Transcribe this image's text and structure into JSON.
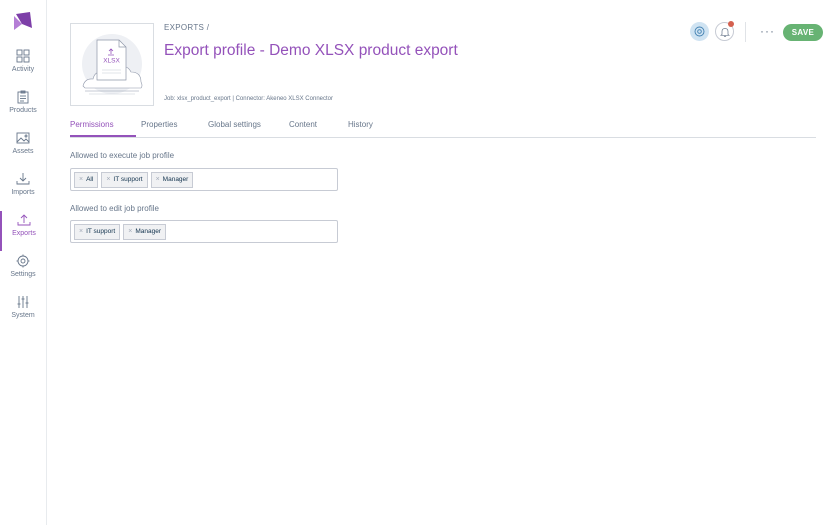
{
  "colors": {
    "accent": "#9452ba",
    "save": "#67b373",
    "notification": "#d4604f",
    "help": "#cfe3f2"
  },
  "sidebar": {
    "items": [
      {
        "label": "Activity",
        "icon": "grid-icon",
        "active": false
      },
      {
        "label": "Products",
        "icon": "clipboard-icon",
        "active": false
      },
      {
        "label": "Assets",
        "icon": "image-icon",
        "active": false
      },
      {
        "label": "Imports",
        "icon": "import-icon",
        "active": false
      },
      {
        "label": "Exports",
        "icon": "export-icon",
        "active": true
      },
      {
        "label": "Settings",
        "icon": "gear-icon",
        "active": false
      },
      {
        "label": "System",
        "icon": "sliders-icon",
        "active": false
      }
    ]
  },
  "header": {
    "breadcrumb": "EXPORTS /",
    "title": "Export profile - Demo XLSX product export",
    "meta": "Job: xlsx_product_export | Connector: Akeneo XLSX Connector",
    "thumbnail_text": "XLSX",
    "more_label": "···",
    "save_label": "SAVE"
  },
  "tabs": [
    {
      "label": "Permissions",
      "active": true
    },
    {
      "label": "Properties",
      "active": false
    },
    {
      "label": "Global settings",
      "active": false
    },
    {
      "label": "Content",
      "active": false
    },
    {
      "label": "History",
      "active": false
    }
  ],
  "permissions": {
    "execute": {
      "label": "Allowed to execute job profile",
      "chips": [
        "All",
        "IT support",
        "Manager"
      ]
    },
    "edit": {
      "label": "Allowed to edit job profile",
      "chips": [
        "IT support",
        "Manager"
      ]
    }
  }
}
